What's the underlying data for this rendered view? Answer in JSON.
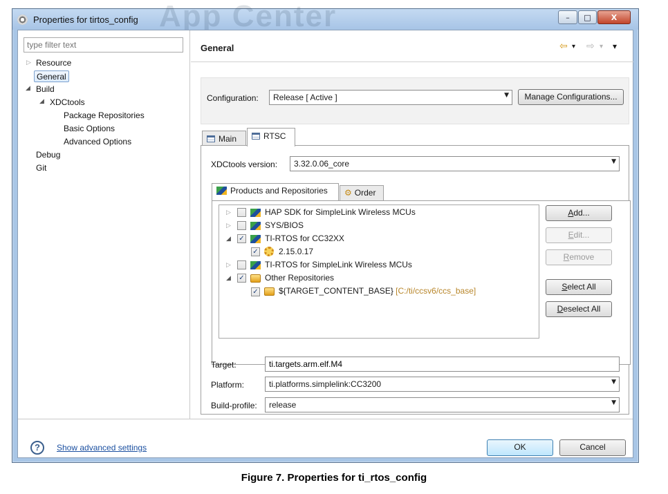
{
  "window": {
    "title": "Properties for tirtos_config",
    "watermark": "App Center",
    "controls": {
      "minimize": "–",
      "maximize": "□",
      "close": "X"
    }
  },
  "filter": {
    "placeholder": "type filter text"
  },
  "tree": [
    {
      "label": "Resource",
      "twisty": "▷"
    },
    {
      "label": "General",
      "selected": true
    },
    {
      "label": "Build",
      "twisty": "◢"
    },
    {
      "label": "XDCtools",
      "twisty": "◢"
    },
    {
      "label": "Package Repositories"
    },
    {
      "label": "Basic Options"
    },
    {
      "label": "Advanced Options"
    },
    {
      "label": "Debug"
    },
    {
      "label": "Git"
    }
  ],
  "header": {
    "title": "General",
    "back_icon": "⇦",
    "forward_icon": "⇨",
    "menu_icon": "▾"
  },
  "configuration": {
    "label": "Configuration:",
    "value": "Release  [ Active ]",
    "manage_label": "Manage Configurations..."
  },
  "tabs": [
    {
      "label": "Main",
      "active": false
    },
    {
      "label": "RTSC",
      "active": true
    }
  ],
  "xdctools": {
    "label": "XDCtools version:",
    "value": "3.32.0.06_core"
  },
  "subtabs": [
    {
      "label": "Products and Repositories",
      "active": true
    },
    {
      "label": "Order",
      "active": false
    }
  ],
  "products": [
    {
      "label": "HAP SDK for SimpleLink Wireless MCUs",
      "checked": false,
      "twisty": "▷"
    },
    {
      "label": "SYS/BIOS",
      "checked": false,
      "twisty": "▷"
    },
    {
      "label": "TI-RTOS for CC32XX",
      "checked": true,
      "twisty": "◢"
    },
    {
      "label": "2.15.0.17",
      "checked": true
    },
    {
      "label": "TI-RTOS for SimpleLink Wireless MCUs",
      "checked": false,
      "twisty": "▷"
    },
    {
      "label": "Other Repositories",
      "checked": true,
      "twisty": "◢"
    },
    {
      "label": "${TARGET_CONTENT_BASE}",
      "hint": "[C:/ti/ccsv6/ccs_base]",
      "checked": true
    }
  ],
  "side_buttons": {
    "add": {
      "mnemonic": "A",
      "rest": "dd..."
    },
    "edit": {
      "mnemonic": "E",
      "rest": "dit..."
    },
    "remove": {
      "mnemonic": "R",
      "rest": "emove"
    },
    "select_all": {
      "mnemonic": "S",
      "rest": "elect All"
    },
    "deselect_all": {
      "mnemonic": "D",
      "rest": "eselect All"
    }
  },
  "fields": {
    "target": {
      "label": "Target:",
      "value": "ti.targets.arm.elf.M4"
    },
    "platform": {
      "label": "Platform:",
      "value": "ti.platforms.simplelink:CC3200"
    },
    "build_profile": {
      "label": "Build-profile:",
      "value": "release"
    }
  },
  "footer": {
    "help_icon": "?",
    "advanced_link": "Show advanced settings",
    "ok": "OK",
    "cancel": "Cancel"
  },
  "caption": "Figure 7. Properties for ti_rtos_config",
  "colors": {
    "accent": "#3c7fb1",
    "link": "#1a4fa0",
    "frame": "#a9c6e6",
    "selection": "#dcebfc"
  }
}
